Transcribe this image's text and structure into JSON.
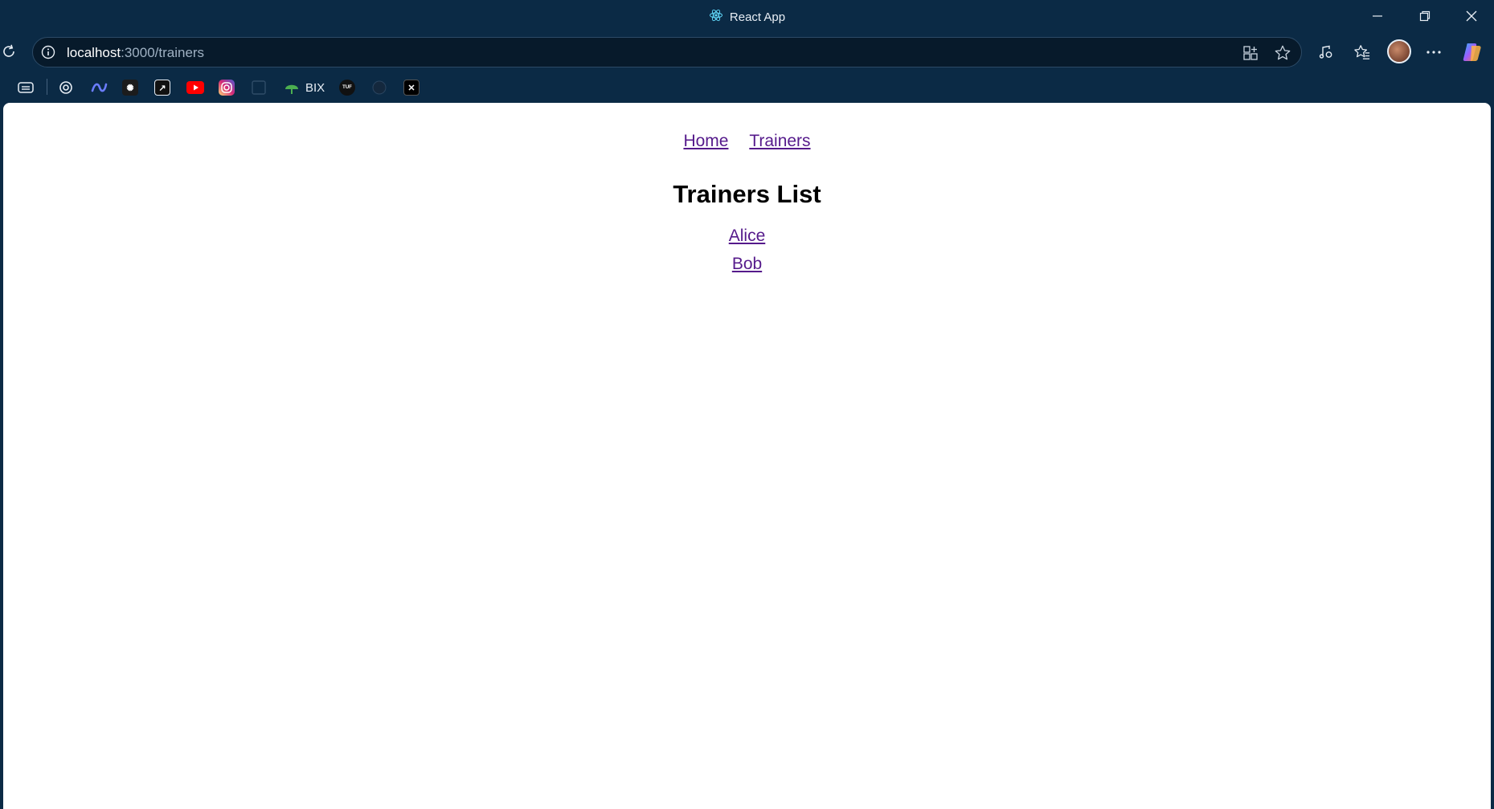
{
  "window": {
    "title": "React App",
    "icon": "react-logo-icon",
    "controls": [
      "minimize-icon",
      "restore-icon",
      "close-icon"
    ]
  },
  "browser": {
    "url_host": "localhost",
    "url_rest": ":3000/trainers",
    "omnibox_icons": [
      "app-available-icon",
      "favorite-star-icon"
    ],
    "toolbar_icons": [
      "media-control-icon",
      "favorites-icon",
      "profile-avatar",
      "more-options-icon",
      "copilot-icon"
    ]
  },
  "bookmarks": {
    "items": [
      {
        "icon": "reading-view-icon"
      },
      {
        "icon": "chatgpt-icon"
      },
      {
        "icon": "claude-icon"
      },
      {
        "icon": "github-copilot-icon"
      },
      {
        "icon": "bookmark-app-icon"
      },
      {
        "icon": "youtube-icon"
      },
      {
        "icon": "instagram-icon"
      },
      {
        "icon": "faded-app-icon"
      },
      {
        "icon": "bix-icon",
        "label": "BIX"
      },
      {
        "icon": "tuf-icon",
        "label": "TUF"
      },
      {
        "icon": "github-icon"
      },
      {
        "icon": "x-icon"
      }
    ]
  },
  "app": {
    "nav": {
      "home": "Home",
      "trainers": "Trainers"
    },
    "heading": "Trainers List",
    "trainers": [
      "Alice",
      "Bob"
    ],
    "colors": {
      "link": "#551a8b",
      "background": "#ffffff",
      "chrome": "#0b2a45"
    }
  }
}
